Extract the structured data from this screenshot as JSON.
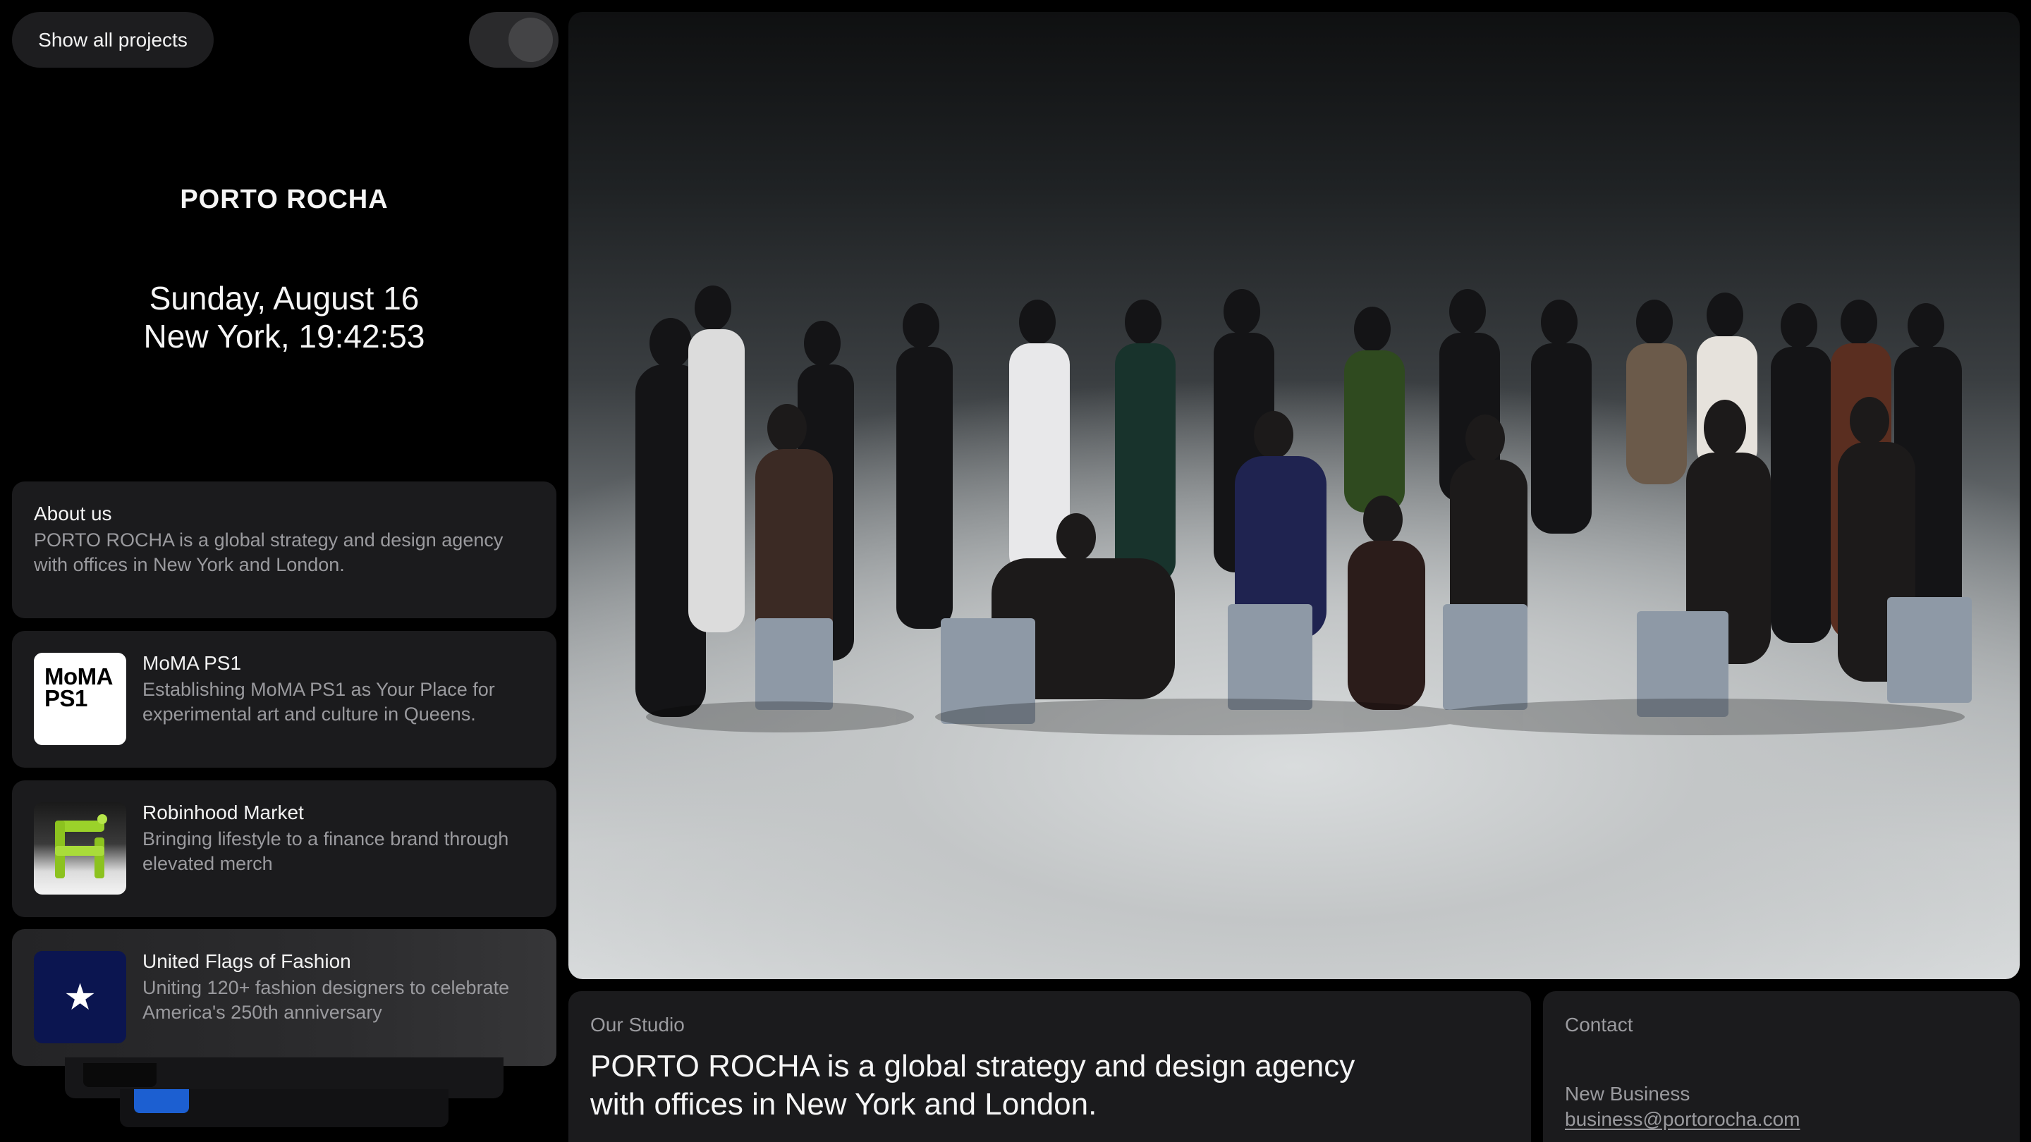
{
  "header": {
    "show_all_label": "Show all projects"
  },
  "brand": {
    "name": "PORTO ROCHA"
  },
  "clock": {
    "date": "Sunday, August 16",
    "location_time": "New York, 19:42:53"
  },
  "about": {
    "title": "About us",
    "text": "PORTO ROCHA is a global strategy and design agency with offices in New York and London."
  },
  "projects": [
    {
      "thumb_text": "MoMA PS1",
      "thumb_icon": "moma-ps1-logo",
      "title": "MoMA PS1",
      "description": "Establishing MoMA PS1 as Your Place for experimental art and culture in Queens."
    },
    {
      "thumb_icon": "robinhood-chair-logo",
      "title": "Robinhood Market",
      "description": "Bringing lifestyle to a finance brand through elevated merch"
    },
    {
      "thumb_icon": "star-icon",
      "thumb_glyph": "★",
      "title": "United Flags of Fashion",
      "description": "Uniting 120+ fashion designers to celebrate America's 250th anniversary"
    }
  ],
  "studio": {
    "label": "Our Studio",
    "text": "PORTO ROCHA is a global strategy and design agency with offices in New York and London."
  },
  "contact": {
    "label": "Contact",
    "subtitle": "New Business",
    "email": "business@portorocha.com"
  },
  "colors": {
    "background": "#000000",
    "card": "#1b1b1d",
    "muted_text": "#9a9a9e",
    "flags_navy": "#0b1550",
    "robinhood_green": "#9bd22a"
  }
}
